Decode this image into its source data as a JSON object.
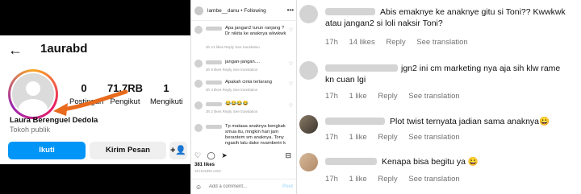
{
  "profile": {
    "username": "1aurabd",
    "back_icon": "←",
    "stats": [
      {
        "value": "0",
        "label": "Postingan"
      },
      {
        "value": "71,7RB",
        "label": "Pengikut"
      },
      {
        "value": "1",
        "label": "Mengikuti"
      }
    ],
    "full_name": "Laura Berenguel Dedola",
    "category": "Tokoh publik",
    "follow_label": "Ikuti",
    "message_label": "Kirim Pesan",
    "add_person_icon": "+👤",
    "highlight_arrow_color": "#e86a1c"
  },
  "post": {
    "username": "lambe__danu",
    "follow_text": "• Following",
    "more_icon": "•••",
    "comments": [
      {
        "text": "Apa jangan2 turun ranjang ? Dr nikita ke anaknya wkwkwk",
        "meta": "3h 21 likes Reply See translation"
      },
      {
        "text": "jangan-jangan....",
        "meta": "3h 9 likes Reply See translation"
      },
      {
        "text": "Apakah cinta terlarang",
        "meta": "3h 4 likes Reply See translation"
      },
      {
        "text": "😂😂😂😂",
        "meta": "3h 2 likes Reply See translation"
      },
      {
        "text": "Tp mataaa anaknya bengkak smua itu, mngkin hari jam berantem sm anaknya. Tony ngasih lalu dake nvamberin k",
        "meta": ""
      }
    ],
    "action_icons": [
      "♡",
      "◯",
      "➤"
    ],
    "bookmark_icon": "⊟",
    "likes": "381 likes",
    "time": "16 HOURS AGO",
    "emoji_icon": "☺",
    "add_comment_placeholder": "Add a comment...",
    "post_label": "Post"
  },
  "comments": [
    {
      "text": "Abis emaknye ke anaknye gitu si Toni?? Kwwkwk atau jangan2 si loli naksir Toni?",
      "time": "17h",
      "likes": "14 likes",
      "reply": "Reply",
      "translate": "See translation"
    },
    {
      "text": "jgn2 ini cm marketing nya aja sih klw rame kn cuan lgi",
      "time": "17h",
      "likes": "1 like",
      "reply": "Reply",
      "translate": "See translation"
    },
    {
      "text": "Plot twist ternyata jadian sama anaknya😀",
      "time": "17h",
      "likes": "1 like",
      "reply": "Reply",
      "translate": "See translation"
    },
    {
      "text": "Kenapa bisa begitu ya 😀",
      "time": "17h",
      "likes": "1 like",
      "reply": "Reply",
      "translate": "See translation"
    }
  ]
}
